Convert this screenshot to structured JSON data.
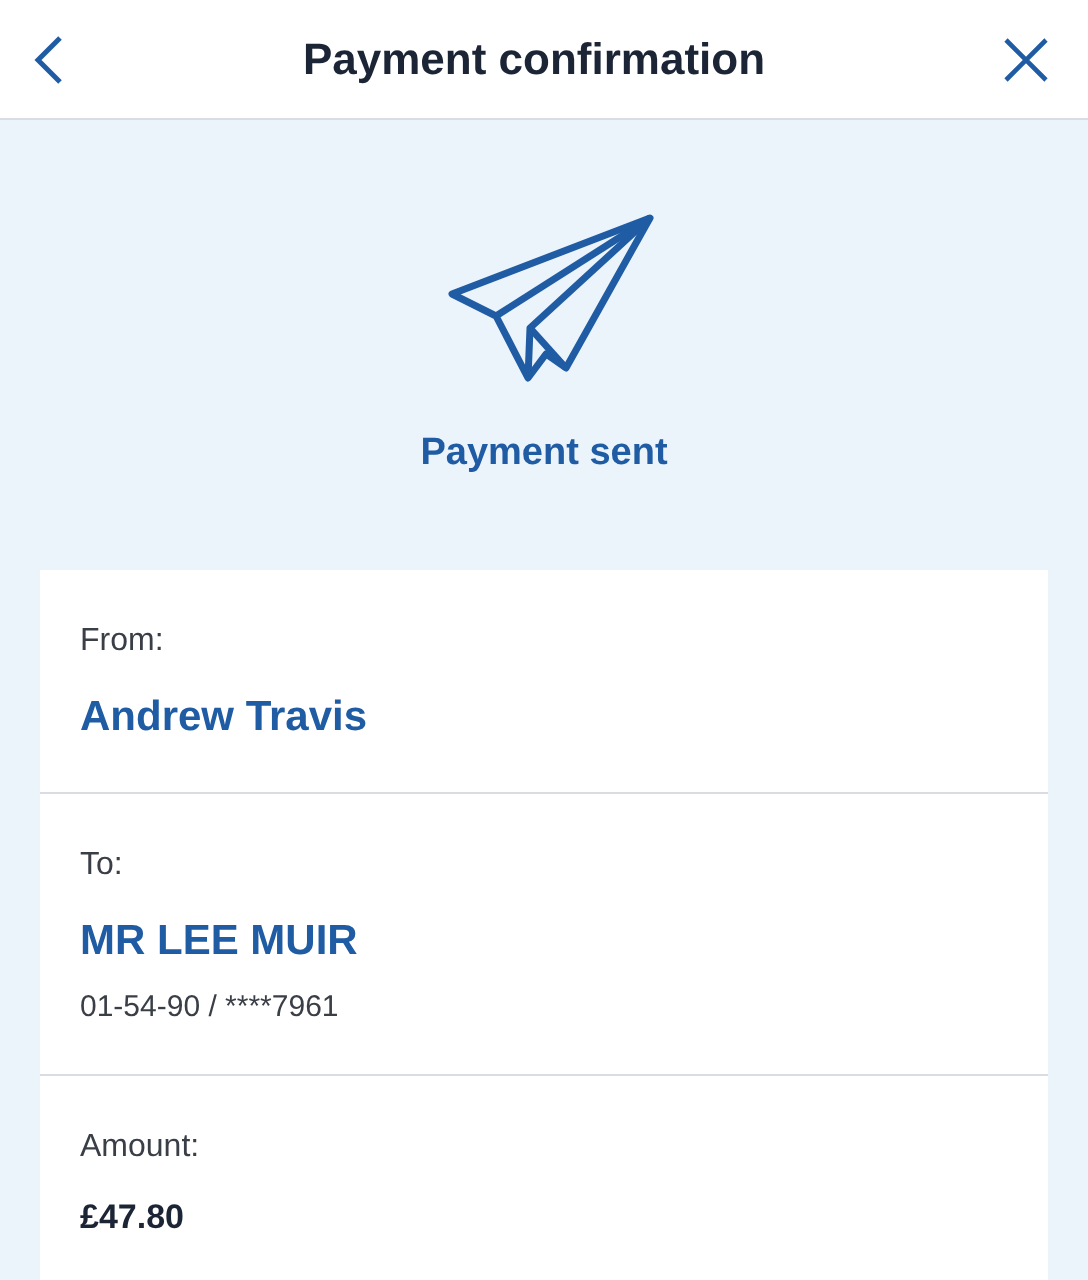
{
  "header": {
    "title": "Payment confirmation"
  },
  "status": {
    "text": "Payment sent"
  },
  "sections": [
    {
      "kind": "party",
      "label": "From:",
      "name": "Andrew Travis"
    },
    {
      "kind": "party",
      "label": "To:",
      "name": "MR LEE MUIR",
      "detail": "01-54-90 / ****7961"
    },
    {
      "kind": "amount",
      "label": "Amount:",
      "value": "£47.80"
    }
  ]
}
